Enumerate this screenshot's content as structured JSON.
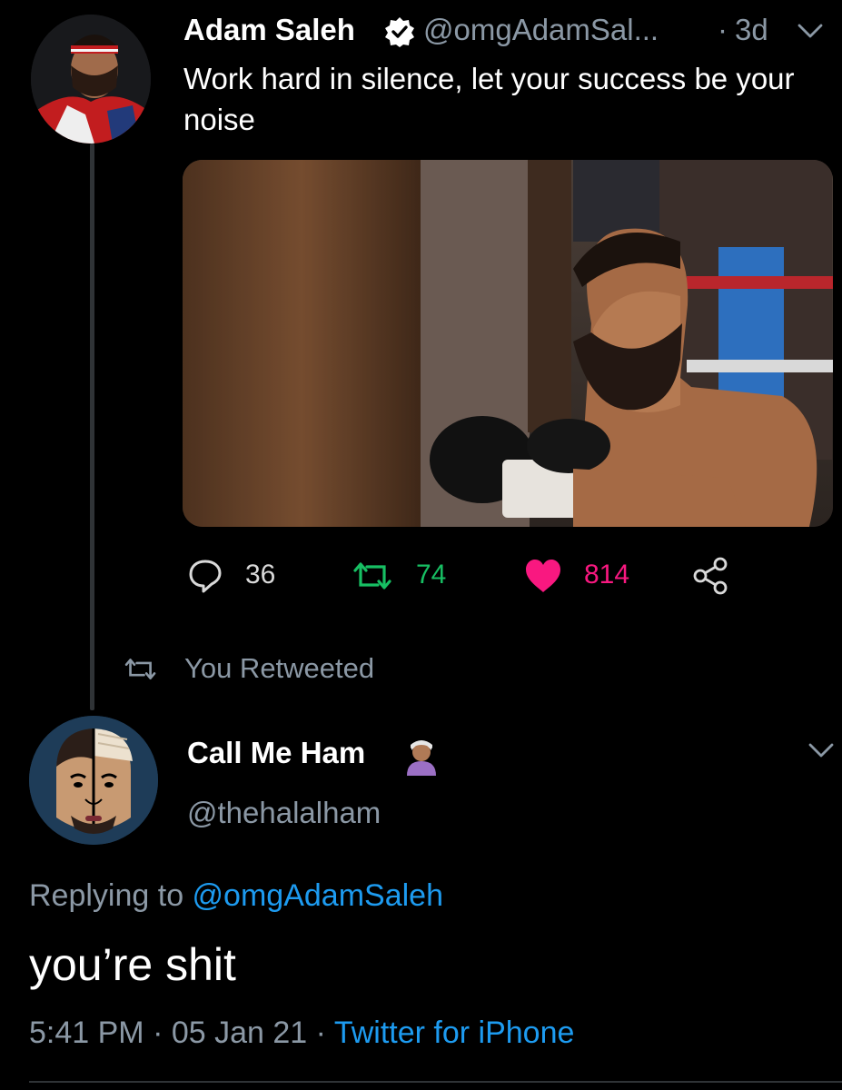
{
  "tweet": {
    "author_name": "Adam Saleh",
    "author_handle": "@omgAdamSal...",
    "separator": "·",
    "time": "3d",
    "text": "Work hard in silence, let your success be your noise",
    "actions": {
      "reply_count": "36",
      "retweet_count": "74",
      "like_count": "814"
    },
    "colors": {
      "retweet": "#17bf63",
      "like": "#f91880",
      "muted": "#8b98a5"
    }
  },
  "retweet_banner": {
    "label": "You Retweeted"
  },
  "reply": {
    "author_name": "Call Me Ham",
    "author_handle": "@thehalalham",
    "replying_prefix": "Replying to ",
    "replying_to": "@omgAdamSaleh",
    "text": "you’re shit",
    "time": "5:41 PM",
    "sep1": "·",
    "date": "05 Jan 21",
    "sep2": "·",
    "source": "Twitter for iPhone",
    "link_color": "#1d9bf0"
  }
}
